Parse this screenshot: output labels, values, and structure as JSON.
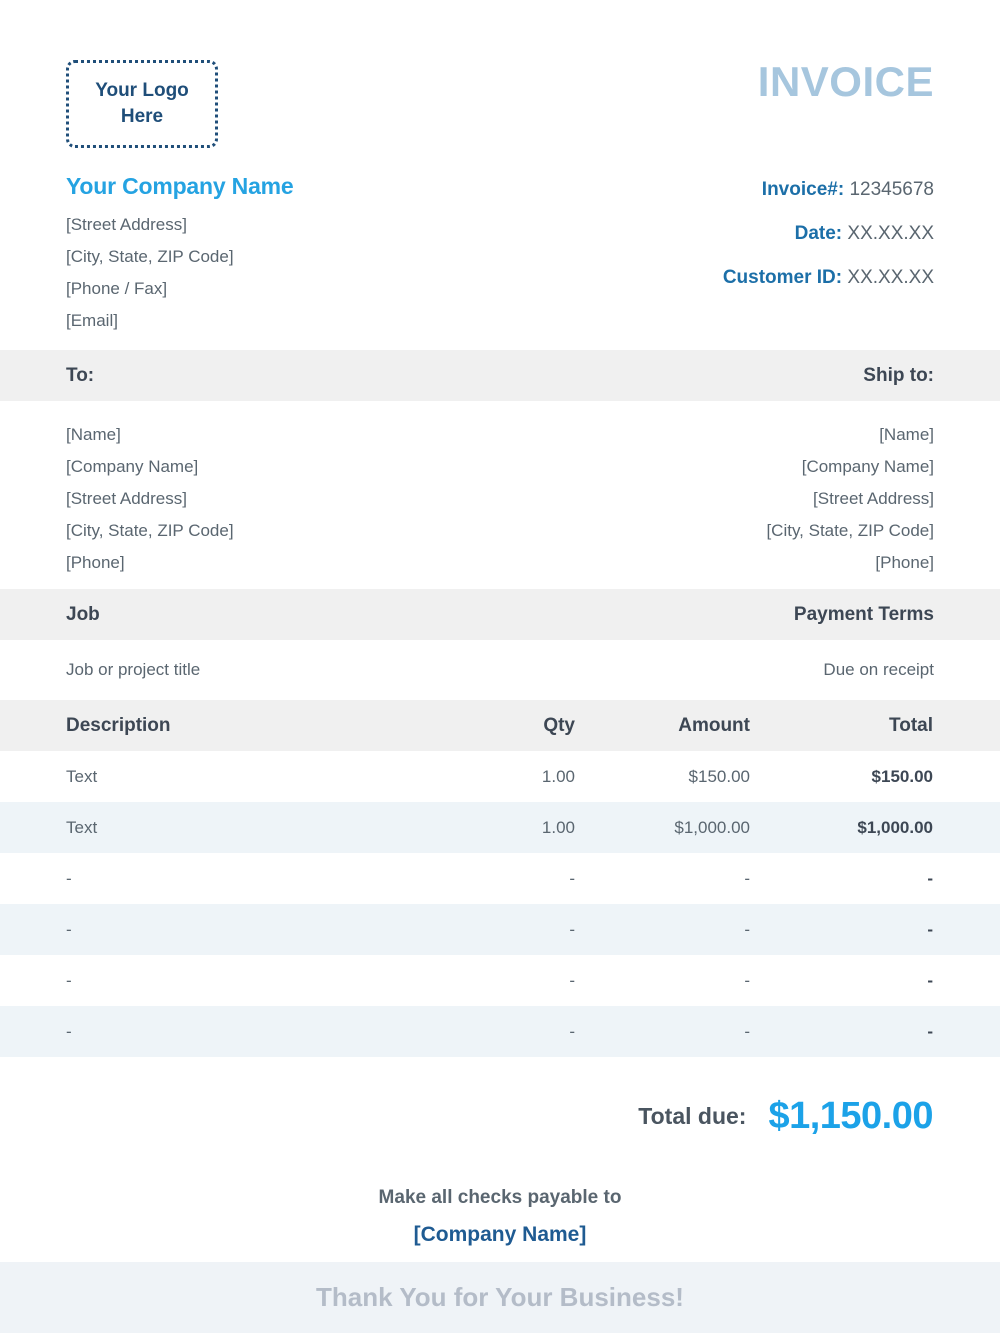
{
  "header": {
    "logo_placeholder": "Your Logo\nHere",
    "company_name": "Your Company Name",
    "company_address": [
      "[Street Address]",
      "[City, State, ZIP Code]",
      "[Phone / Fax]",
      "[Email]"
    ],
    "document_title": "INVOICE",
    "meta": [
      {
        "label": "Invoice#:",
        "value": "12345678"
      },
      {
        "label": "Date:",
        "value": "XX.XX.XX"
      },
      {
        "label": "Customer ID:",
        "value": "XX.XX.XX"
      }
    ]
  },
  "bill_to": {
    "heading": "To:",
    "lines": [
      "[Name]",
      "[Company Name]",
      "[Street Address]",
      "[City, State, ZIP Code]",
      "[Phone]"
    ]
  },
  "ship_to": {
    "heading": "Ship to:",
    "lines": [
      "[Name]",
      "[Company Name]",
      "[Street Address]",
      "[City, State, ZIP Code]",
      "[Phone]"
    ]
  },
  "job": {
    "heading": "Job",
    "value": "Job or project title"
  },
  "payment_terms": {
    "heading": "Payment Terms",
    "value": "Due on receipt"
  },
  "items_table": {
    "columns": [
      "Description",
      "Qty",
      "Amount",
      "Total"
    ],
    "rows": [
      {
        "description": "Text",
        "qty": "1.00",
        "amount": "$150.00",
        "total": "$150.00"
      },
      {
        "description": "Text",
        "qty": "1.00",
        "amount": "$1,000.00",
        "total": "$1,000.00"
      },
      {
        "description": "-",
        "qty": "-",
        "amount": "-",
        "total": "-"
      },
      {
        "description": "-",
        "qty": "-",
        "amount": "-",
        "total": "-"
      },
      {
        "description": "-",
        "qty": "-",
        "amount": "-",
        "total": "-"
      },
      {
        "description": "-",
        "qty": "-",
        "amount": "-",
        "total": "-"
      }
    ]
  },
  "summary": {
    "total_due_label": "Total due:",
    "total_due_value": "$1,150.00"
  },
  "payable": {
    "line1": "Make all checks payable to",
    "line2": "[Company Name]"
  },
  "footer": {
    "message": "Thank You for Your Business!"
  },
  "colors": {
    "accent_blue": "#1ca2e8",
    "title_blue": "#a6c6de",
    "label_blue": "#1c6fa8",
    "dark_blue": "#1f4e79",
    "band_gray": "#f0f0f0",
    "stripe_blue": "#eef4f8",
    "footer_bg": "#eff3f7",
    "footer_text": "#b4bcc8"
  }
}
